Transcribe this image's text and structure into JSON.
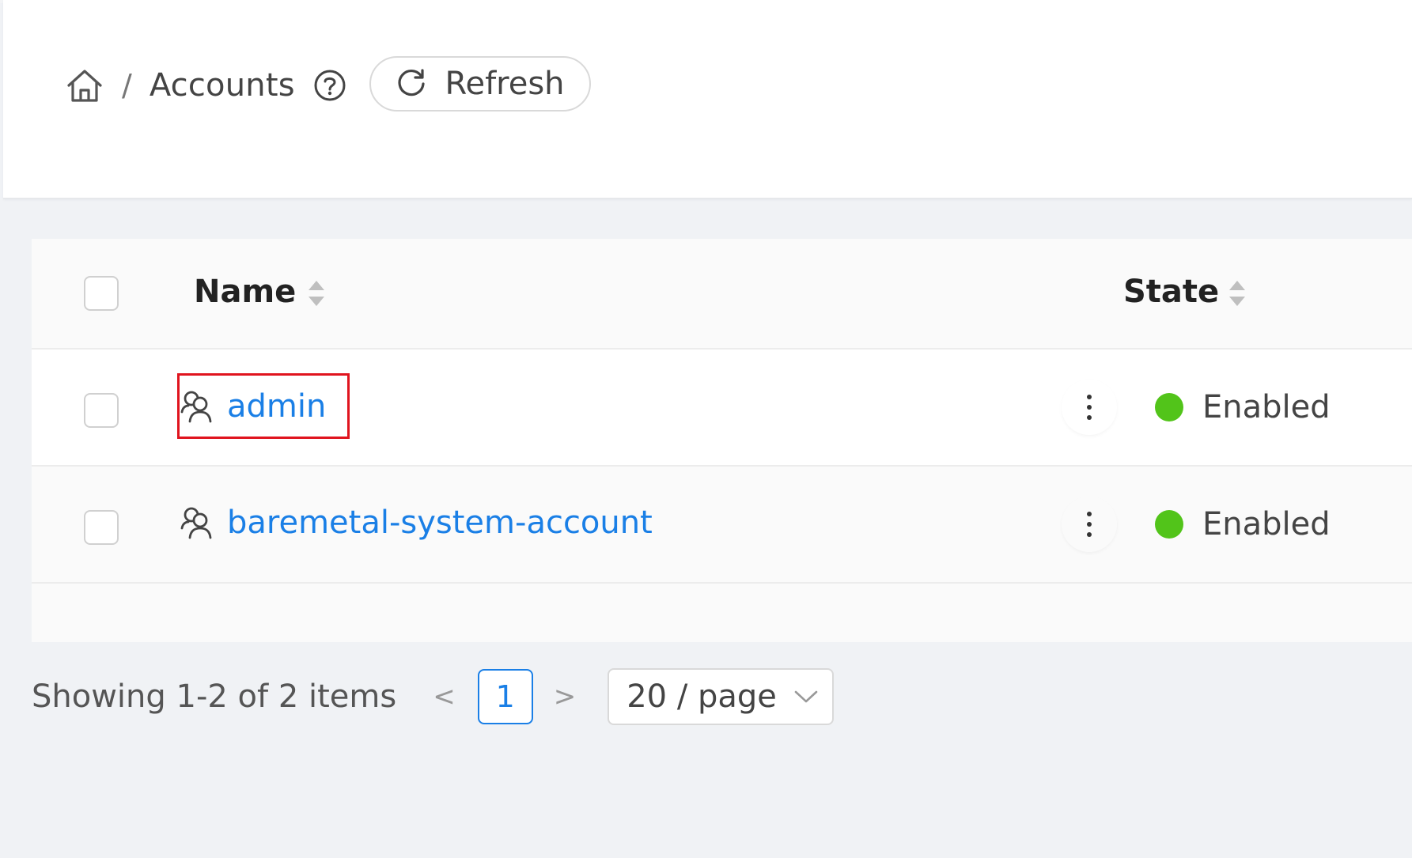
{
  "breadcrumb": {
    "home_icon": "home-icon",
    "separator": "/",
    "current": "Accounts",
    "help_icon": "question-circle-icon"
  },
  "toolbar": {
    "refresh_label": "Refresh",
    "refresh_icon": "reload-icon"
  },
  "table": {
    "columns": [
      {
        "label": "Name",
        "sortable": true
      },
      {
        "label": "State",
        "sortable": true
      }
    ],
    "rows": [
      {
        "name": "admin",
        "icon": "account-icon",
        "state": "Enabled",
        "state_color": "#52c41a",
        "highlighted": true
      },
      {
        "name": "baremetal-system-account",
        "icon": "account-icon",
        "state": "Enabled",
        "state_color": "#52c41a",
        "highlighted": false
      }
    ]
  },
  "pagination": {
    "summary": "Showing 1-2 of 2 items",
    "prev": "<",
    "current_page": "1",
    "next": ">",
    "page_size": "20 / page"
  },
  "colors": {
    "link": "#1a7fe6",
    "enabled": "#52c41a",
    "highlight": "#e0141e"
  }
}
